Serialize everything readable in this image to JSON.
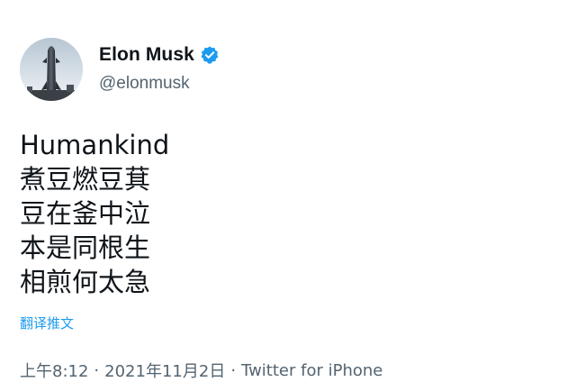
{
  "author": {
    "display_name": "Elon Musk",
    "handle": "@elonmusk",
    "verified_color": "#1d9bf0",
    "avatar_icon": "starship-rocket-avatar"
  },
  "tweet": {
    "lines": [
      "Humankind",
      "煮豆燃豆萁",
      "豆在釜中泣",
      "本是同根生",
      "相煎何太急"
    ],
    "translate_label": "翻译推文"
  },
  "meta": {
    "time": "上午8:12",
    "separator": "·",
    "date": "2021年11月2日",
    "source": "Twitter for iPhone"
  },
  "colors": {
    "text": "#0f1419",
    "secondary": "#536471",
    "link": "#1d9bf0"
  }
}
